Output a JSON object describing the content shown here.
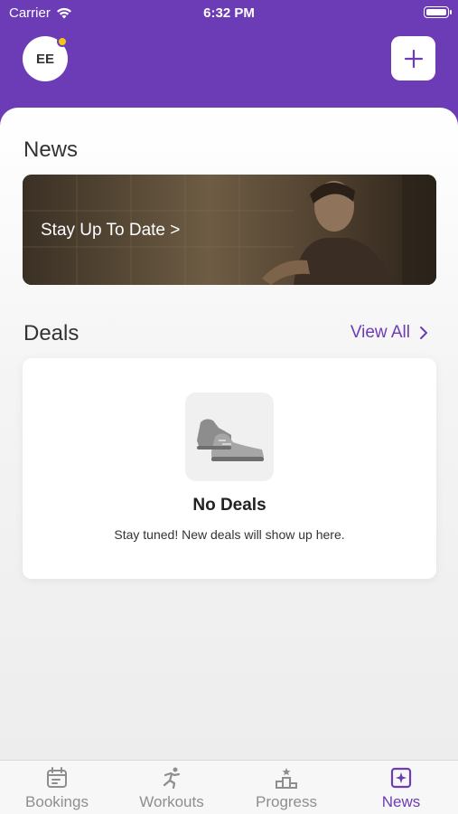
{
  "status_bar": {
    "carrier": "Carrier",
    "time": "6:32 PM"
  },
  "header": {
    "avatar_initials": "EE"
  },
  "news": {
    "section_title": "News",
    "banner_text": "Stay Up To Date >"
  },
  "deals": {
    "section_title": "Deals",
    "view_all_label": "View All",
    "empty_title": "No Deals",
    "empty_subtitle": "Stay tuned! New deals will show up here."
  },
  "tabbar": {
    "active_color": "#6b3cb6",
    "inactive_color": "#8e8e8e",
    "items": [
      {
        "label": "Bookings",
        "icon": "calendar-icon"
      },
      {
        "label": "Workouts",
        "icon": "running-figure-icon"
      },
      {
        "label": "Progress",
        "icon": "podium-icon"
      },
      {
        "label": "News",
        "icon": "news-icon"
      }
    ],
    "active": "News"
  },
  "colors": {
    "brand": "#6b3cb6",
    "notification_dot": "#f5c518"
  }
}
